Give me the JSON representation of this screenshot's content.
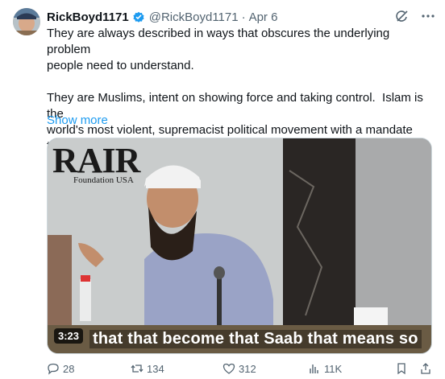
{
  "tweet": {
    "display_name": "RickBoyd1171",
    "handle": "@RickBoyd1171",
    "separator": "·",
    "date": "Apr 6",
    "text": "They are always described in ways that obscures the underlying problem\npeople need to understand.\n\nThey are Muslims, intent on showing force and taking control.  Islam is the\nworld's most violent, supremacist political movement with a mandate to\ncreate a global Islamic government",
    "show_more": "Show more"
  },
  "media": {
    "duration": "3:23",
    "subtitle": "that that become that Saab that means so",
    "watermark_title": "RAIR",
    "watermark_subtitle": "Foundation USA"
  },
  "actions": {
    "replies": "28",
    "reposts": "134",
    "likes": "312",
    "views": "11K"
  },
  "colors": {
    "accent": "#1d9bf0",
    "secondary_text": "#536471"
  }
}
